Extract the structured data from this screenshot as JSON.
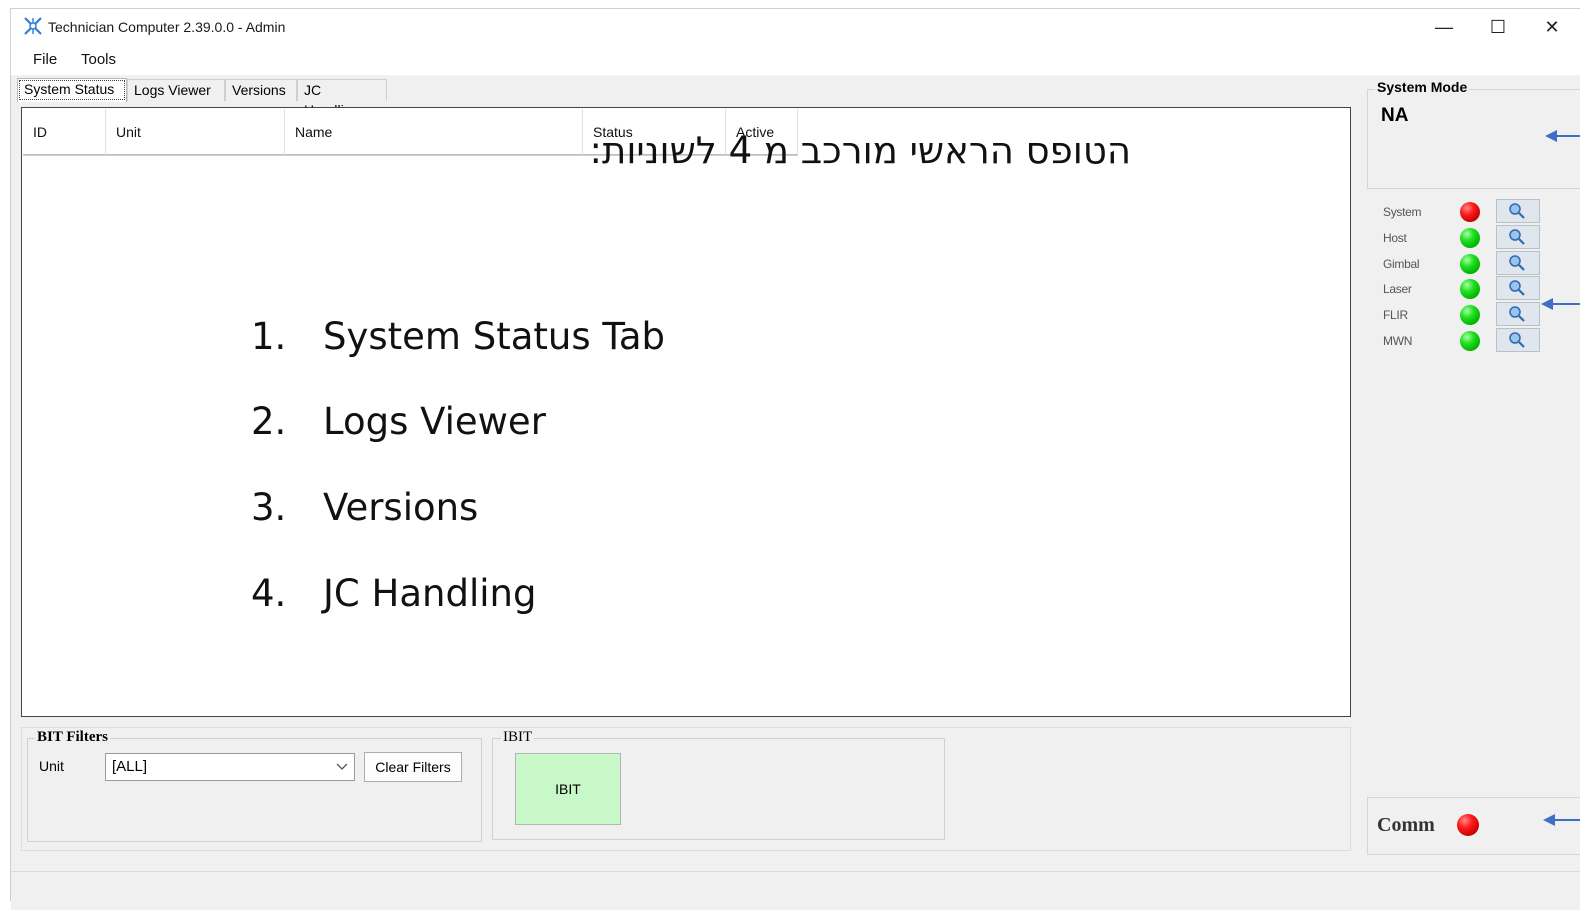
{
  "window": {
    "title": "Technician Computer 2.39.0.0  -  Admin",
    "controls": {
      "minimize": "—",
      "maximize": "☐",
      "close": "✕"
    }
  },
  "menu": {
    "items": [
      "File",
      "Tools"
    ]
  },
  "tabs": [
    {
      "label": "System Status",
      "active": true
    },
    {
      "label": "Logs Viewer",
      "active": false
    },
    {
      "label": "Versions",
      "active": false
    },
    {
      "label": "JC Handling",
      "active": false
    }
  ],
  "table": {
    "columns": [
      "ID",
      "Unit",
      "Name",
      "Status",
      "Active"
    ]
  },
  "overlay": {
    "title": "הטופס הראשי מורכב מ 4 לשוניות:",
    "items": [
      {
        "num": "1.",
        "text": "System Status Tab"
      },
      {
        "num": "2.",
        "text": "Logs Viewer"
      },
      {
        "num": "3.",
        "text": "Versions"
      },
      {
        "num": "4.",
        "text": "JC Handling"
      }
    ]
  },
  "bit_filters": {
    "group_label": "BIT Filters",
    "unit_label": "Unit",
    "unit_value": "[ALL]",
    "clear_button": "Clear Filters"
  },
  "ibit": {
    "group_label": "IBIT",
    "button_label": "IBIT",
    "button_color": "#c8f7c8"
  },
  "system_mode": {
    "label": "System Mode",
    "value": "NA"
  },
  "statuses": [
    {
      "label": "System",
      "state": "red"
    },
    {
      "label": "Host",
      "state": "green"
    },
    {
      "label": "Gimbal",
      "state": "green"
    },
    {
      "label": "Laser",
      "state": "green"
    },
    {
      "label": "FLIR",
      "state": "green"
    },
    {
      "label": "MWN",
      "state": "green"
    }
  ],
  "comm": {
    "label": "Comm",
    "state": "red"
  },
  "colors": {
    "annotation_arrow": "#3f6fc4",
    "led_red": "#e00000",
    "led_green": "#10c010"
  }
}
